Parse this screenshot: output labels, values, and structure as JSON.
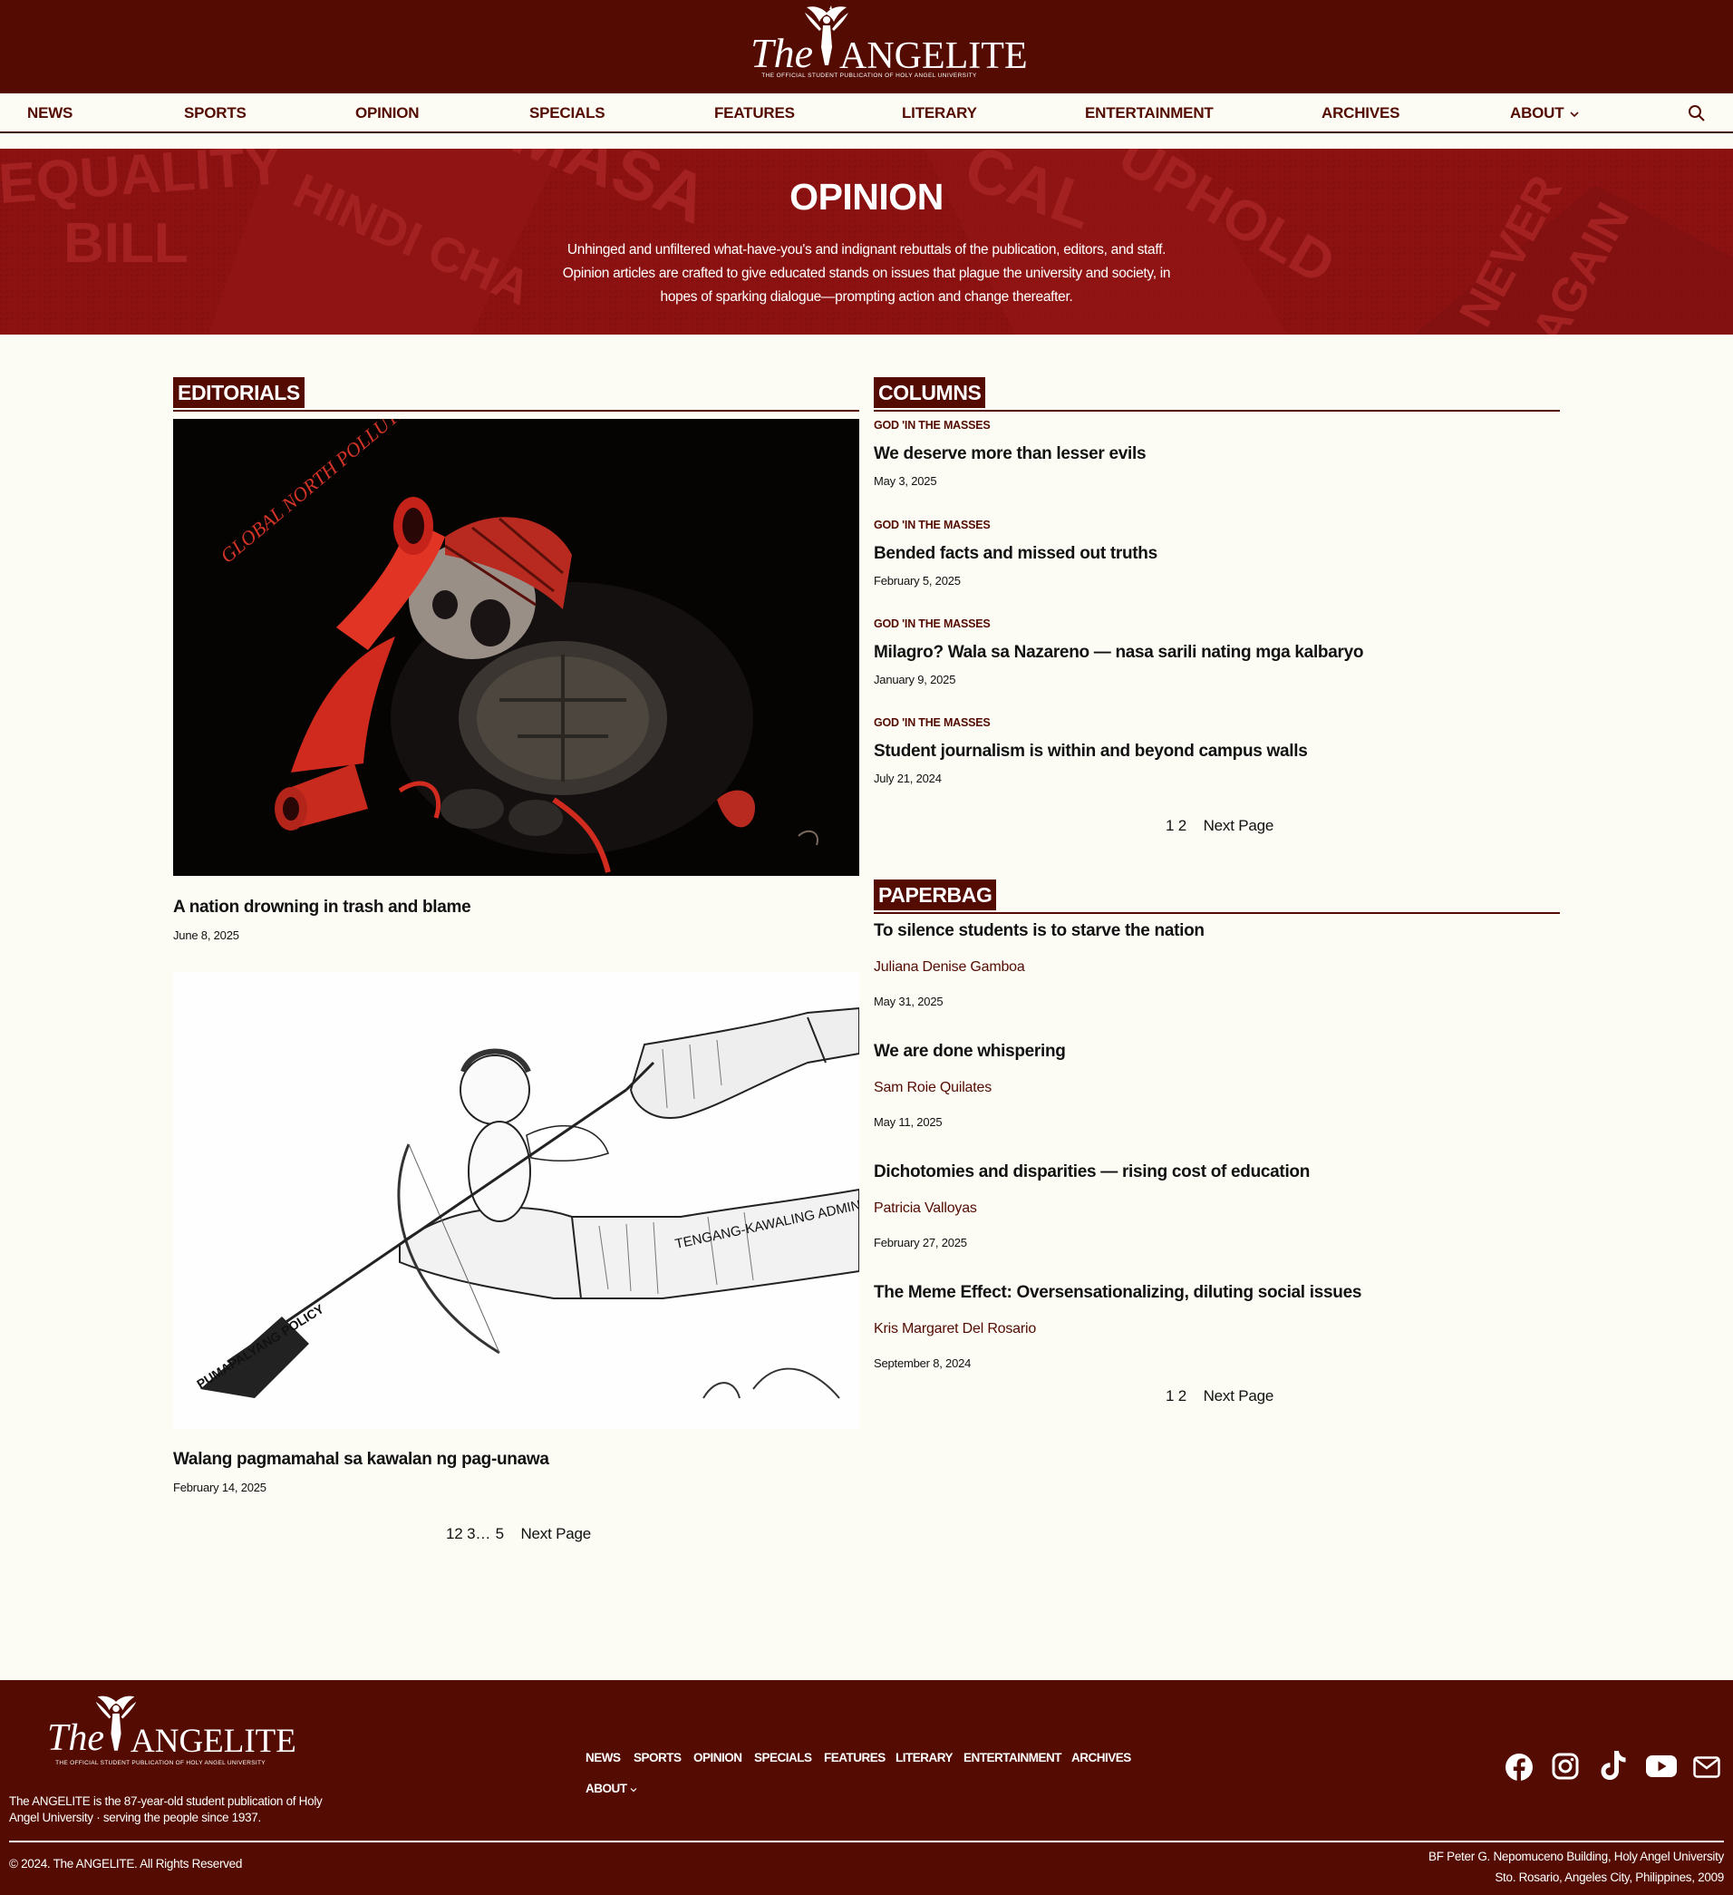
{
  "brand": {
    "the": "The",
    "name": "ANGELITE",
    "tagline": "THE OFFICIAL STUDENT PUBLICATION OF HOLY ANGEL UNIVERSITY"
  },
  "nav": {
    "items": [
      "NEWS",
      "SPORTS",
      "OPINION",
      "SPECIALS",
      "FEATURES",
      "LITERARY",
      "ENTERTAINMENT",
      "ARCHIVES",
      "ABOUT"
    ]
  },
  "hero": {
    "title": "OPINION",
    "description": "Unhinged and unfiltered what-have-you's and indignant rebuttals of the publication, editors, and staff. Opinion articles are crafted to give educated stands on issues that plague the university and society, in hopes of sparking dialogue—prompting action and change thereafter."
  },
  "editorials": {
    "heading": "EDITORIALS",
    "articles": [
      {
        "title": "A nation drowning in trash and blame",
        "date": "June 8, 2025",
        "image_text": "GLOBAL NORTH POLLUTERS"
      },
      {
        "title": "Walang pagmamahal sa kawalan ng pag-unawa",
        "date": "February 14, 2025",
        "image_text_1": "TENGANG-KAWALING ADMIN",
        "image_text_2": "PUMAPALYANG POLICY"
      }
    ],
    "pager": {
      "pages": [
        "1",
        "2",
        "3",
        "…",
        "5"
      ],
      "next": "Next Page"
    }
  },
  "columns": {
    "heading": "COLUMNS",
    "articles": [
      {
        "kicker": "GOD 'IN THE MASSES",
        "title": "We deserve more than lesser evils",
        "date": "May 3, 2025"
      },
      {
        "kicker": "GOD 'IN THE MASSES",
        "title": "Bended facts and missed out truths",
        "date": "February 5, 2025"
      },
      {
        "kicker": "GOD 'IN THE MASSES",
        "title": "Milagro? Wala sa Nazareno — nasa sarili nating mga kalbaryo",
        "date": "January 9, 2025"
      },
      {
        "kicker": "GOD 'IN THE MASSES",
        "title": "Student journalism is within and beyond campus walls",
        "date": "July 21, 2024"
      }
    ],
    "pager": {
      "pages": [
        "1",
        "2"
      ],
      "next": "Next Page"
    }
  },
  "paperbag": {
    "heading": "PAPERBAG",
    "articles": [
      {
        "title": "To silence students is to starve the nation",
        "author": "Juliana Denise Gamboa",
        "date": "May 31, 2025"
      },
      {
        "title": "We are done whispering",
        "author": "Sam Roie Quilates",
        "date": "May 11, 2025"
      },
      {
        "title": "Dichotomies and disparities — rising cost of education",
        "author": "Patricia Valloyas",
        "date": "February 27, 2025"
      },
      {
        "title": "The Meme Effect: Oversensationalizing, diluting social issues",
        "author": "Kris Margaret Del Rosario",
        "date": "September 8, 2024"
      }
    ],
    "pager": {
      "pages": [
        "1",
        "2"
      ],
      "next": "Next Page"
    }
  },
  "footer": {
    "description": "The ANGELITE is the 87-year-old student publication of Holy Angel University · serving the people since 1937.",
    "nav": [
      "NEWS",
      "SPORTS",
      "OPINION",
      "SPECIALS",
      "FEATURES",
      "LITERARY",
      "ENTERTAINMENT",
      "ARCHIVES",
      "ABOUT"
    ],
    "social": [
      "facebook-icon",
      "instagram-icon",
      "tiktok-icon",
      "youtube-icon",
      "mail-icon"
    ],
    "copyright": "© 2024. The ANGELITE. All Rights Reserved",
    "address_line1": "BF Peter G. Nepomuceno Building, Holy Angel University",
    "address_line2": "Sto. Rosario, Angeles City, Philippines, 2009"
  },
  "colors": {
    "brand": "#530b02",
    "hero": "#8c1212",
    "page": "#fcfcf4"
  }
}
